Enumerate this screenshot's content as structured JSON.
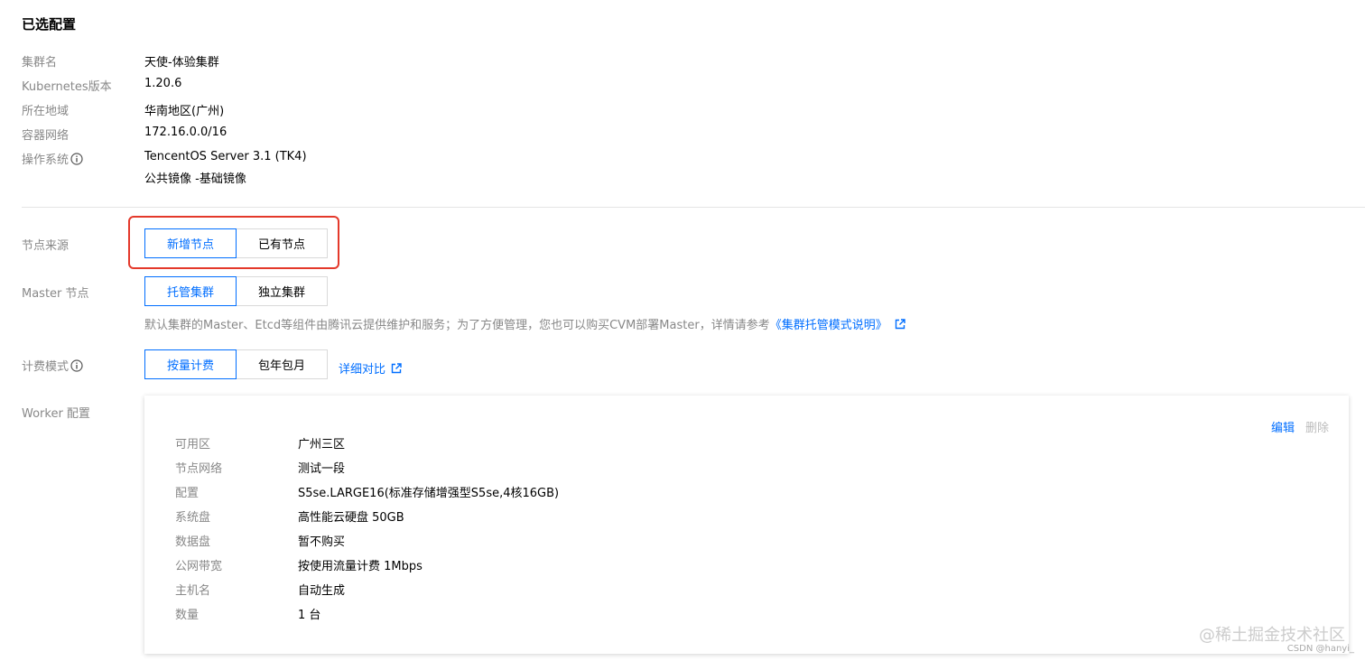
{
  "title": "已选配置",
  "summary": [
    {
      "label": "集群名",
      "value": "天使-体验集群"
    },
    {
      "label": "Kubernetes版本",
      "value": "1.20.6"
    },
    {
      "label": "所在地域",
      "value": "华南地区(广州)"
    },
    {
      "label": "容器网络",
      "value": "172.16.0.0/16"
    },
    {
      "label": "操作系统",
      "value": "TencentOS Server 3.1 (TK4)",
      "value2": "公共镜像 -基础镜像"
    }
  ],
  "node_source": {
    "label": "节点来源",
    "options": [
      "新增节点",
      "已有节点"
    ],
    "selected": 0
  },
  "master": {
    "label": "Master 节点",
    "options": [
      "托管集群",
      "独立集群"
    ],
    "selected": 0,
    "desc": "默认集群的Master、Etcd等组件由腾讯云提供维护和服务；为了方便管理，您也可以购买CVM部署Master，详情请参考",
    "desc_link": "《集群托管模式说明》"
  },
  "billing": {
    "label": "计费模式",
    "options": [
      "按量计费",
      "包年包月"
    ],
    "selected": 0,
    "compare_link": "详细对比"
  },
  "worker": {
    "label": "Worker 配置",
    "edit": "编辑",
    "delete": "删除",
    "rows": [
      {
        "label": "可用区",
        "value": "广州三区"
      },
      {
        "label": "节点网络",
        "value": "测试一段"
      },
      {
        "label": "配置",
        "value": "S5se.LARGE16(标准存储增强型S5se,4核16GB)"
      },
      {
        "label": "系统盘",
        "value": "高性能云硬盘 50GB"
      },
      {
        "label": "数据盘",
        "value": "暂不购买"
      },
      {
        "label": "公网带宽",
        "value": "按使用流量计费 1Mbps"
      },
      {
        "label": "主机名",
        "value": "自动生成"
      },
      {
        "label": "数量",
        "value": "1 台"
      }
    ]
  },
  "watermark": "@稀土掘金技术社区",
  "csdn_mark": "CSDN @hanyi_",
  "colors": {
    "accent": "#006eff",
    "highlight": "#e4392b",
    "label": "#888888"
  },
  "icons": {
    "info": "info-icon",
    "external": "external-link-icon"
  }
}
